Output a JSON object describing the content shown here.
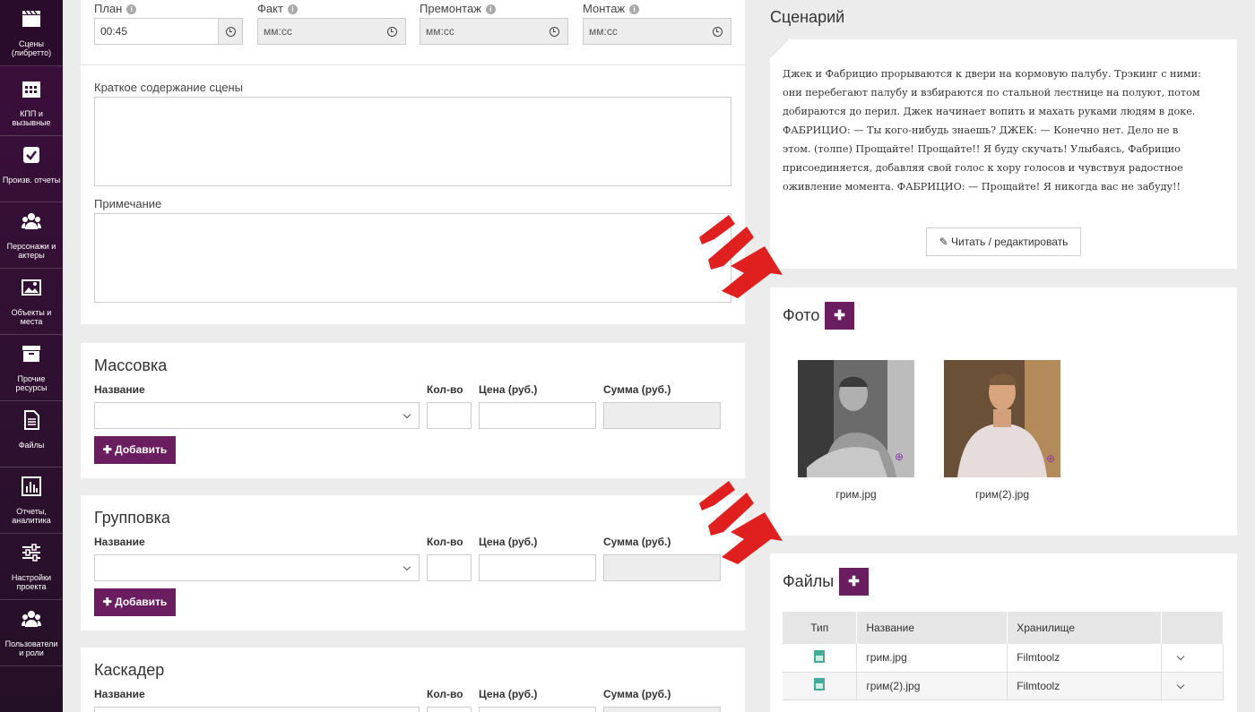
{
  "sidebar": {
    "items": [
      {
        "label": "Сцены (либретто)",
        "icon": "clapperboard-icon"
      },
      {
        "label": "КПП и вызывные",
        "icon": "calendar-icon"
      },
      {
        "label": "Произв. отчеты",
        "icon": "checkbox-icon"
      },
      {
        "label": "Персонажи и актеры",
        "icon": "people-icon"
      },
      {
        "label": "Объекты и места",
        "icon": "image-icon"
      },
      {
        "label": "Прочие ресурсы",
        "icon": "archive-icon"
      },
      {
        "label": "Файлы",
        "icon": "document-icon"
      },
      {
        "label": "Отчеты, аналитика",
        "icon": "bar-chart-icon"
      },
      {
        "label": "Настройки проекта",
        "icon": "sliders-icon"
      },
      {
        "label": "Пользователи и роли",
        "icon": "users-icon"
      }
    ]
  },
  "timing": {
    "plan": {
      "label": "План",
      "value": "00:45"
    },
    "fact": {
      "label": "Факт",
      "placeholder": "мм:сс"
    },
    "premount": {
      "label": "Премонтаж",
      "placeholder": "мм:сс"
    },
    "mount": {
      "label": "Монтаж",
      "placeholder": "мм:сс"
    }
  },
  "summary": {
    "label": "Краткое содержание сцены"
  },
  "note": {
    "label": "Примечание"
  },
  "sections": [
    {
      "title": "Массовка",
      "col_name": "Название",
      "col_qty": "Кол-во",
      "col_price": "Цена (руб.)",
      "col_sum": "Сумма (руб.)",
      "add": "Добавить"
    },
    {
      "title": "Групповка",
      "col_name": "Название",
      "col_qty": "Кол-во",
      "col_price": "Цена (руб.)",
      "col_sum": "Сумма (руб.)",
      "add": "Добавить"
    },
    {
      "title": "Каскадер",
      "col_name": "Название",
      "col_qty": "Кол-во",
      "col_price": "Цена (руб.)",
      "col_sum": "Сумма (руб.)"
    }
  ],
  "scenario": {
    "title": "Сценарий",
    "text": "Джек и Фабрицио прорываются к двери на кормовую палубу. Трэкинг с ними: они перебегают палубу и взбираются по стальной лестнице на полуют, потом добираются до перил. Джек начинает вопить и махать руками людям в доке. ФАБРИЦИО: — Ты кого-нибудь знаешь? ДЖЕК: — Конечно нет. Дело не в этом. (толпе) Прощайте! Прощайте!! Я буду скучать! Улыбаясь, Фабрицио присоединяется, добавляя свой голос к хору голосов и чувствуя радостное оживление момента. ФАБРИЦИО: — Прощайте! Я никогда вас не забуду!!",
    "edit_button": "Читать / редактировать"
  },
  "photos": {
    "title": "Фото",
    "items": [
      {
        "caption": "грим.jpg"
      },
      {
        "caption": "грим(2).jpg"
      }
    ]
  },
  "files": {
    "title": "Файлы",
    "headers": [
      "Тип",
      "Название",
      "Хранилище"
    ],
    "rows": [
      {
        "name": "грим.jpg",
        "storage": "Filmtoolz"
      },
      {
        "name": "грим(2).jpg",
        "storage": "Filmtoolz"
      }
    ]
  },
  "colors": {
    "accent": "#6b1e5f",
    "sidebar": "#3c0f3d",
    "arrow": "#e0201e"
  }
}
